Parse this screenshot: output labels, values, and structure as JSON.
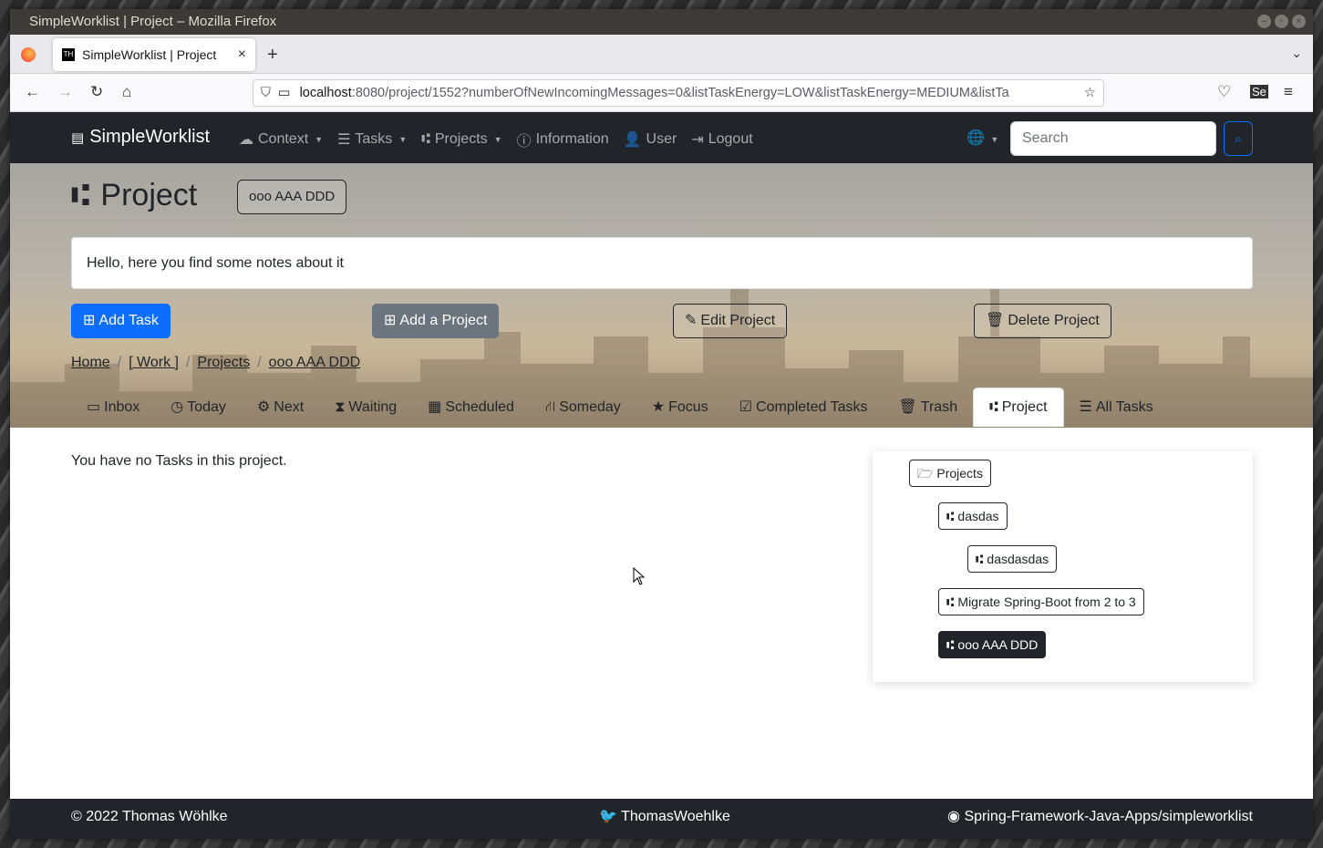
{
  "window": {
    "title": "SimpleWorklist | Project – Mozilla Firefox"
  },
  "browser": {
    "tab_title": "SimpleWorklist | Project",
    "url_host": "localhost",
    "url_rest": ":8080/project/1552?numberOfNewIncomingMessages=0&listTaskEnergy=LOW&listTaskEnergy=MEDIUM&listTa"
  },
  "app_nav": {
    "brand": "SimpleWorklist",
    "items": [
      "Context",
      "Tasks",
      "Projects",
      "Information",
      "User",
      "Logout"
    ],
    "search_placeholder": "Search"
  },
  "project": {
    "heading": "Project",
    "name": "ooo AAA DDD",
    "notes": "Hello, here you find some notes about it"
  },
  "actions": {
    "add_task": "Add Task",
    "add_project": "Add a Project",
    "edit_project": "Edit Project",
    "delete_project": "Delete Project"
  },
  "breadcrumb": [
    "Home",
    "[ Work ]",
    "Projects",
    "ooo AAA DDD"
  ],
  "tabs": [
    "Inbox",
    "Today",
    "Next",
    "Waiting",
    "Scheduled",
    "Someday",
    "Focus",
    "Completed Tasks",
    "Trash",
    "Project",
    "All Tasks"
  ],
  "active_tab": "Project",
  "content": {
    "empty_message": "You have no Tasks in this project."
  },
  "tree": {
    "root": "Projects",
    "nodes": [
      "dasdas",
      "dasdasdas",
      "Migrate Spring-Boot from 2 to 3",
      "ooo AAA DDD"
    ]
  },
  "footer": {
    "copyright": "© 2022 Thomas Wöhlke",
    "twitter": "ThomasWoehlke",
    "github": "Spring-Framework-Java-Apps/simpleworklist"
  },
  "colors": {
    "primary": "#0d6efd",
    "dark": "#212529",
    "secondary": "#6c757d"
  }
}
